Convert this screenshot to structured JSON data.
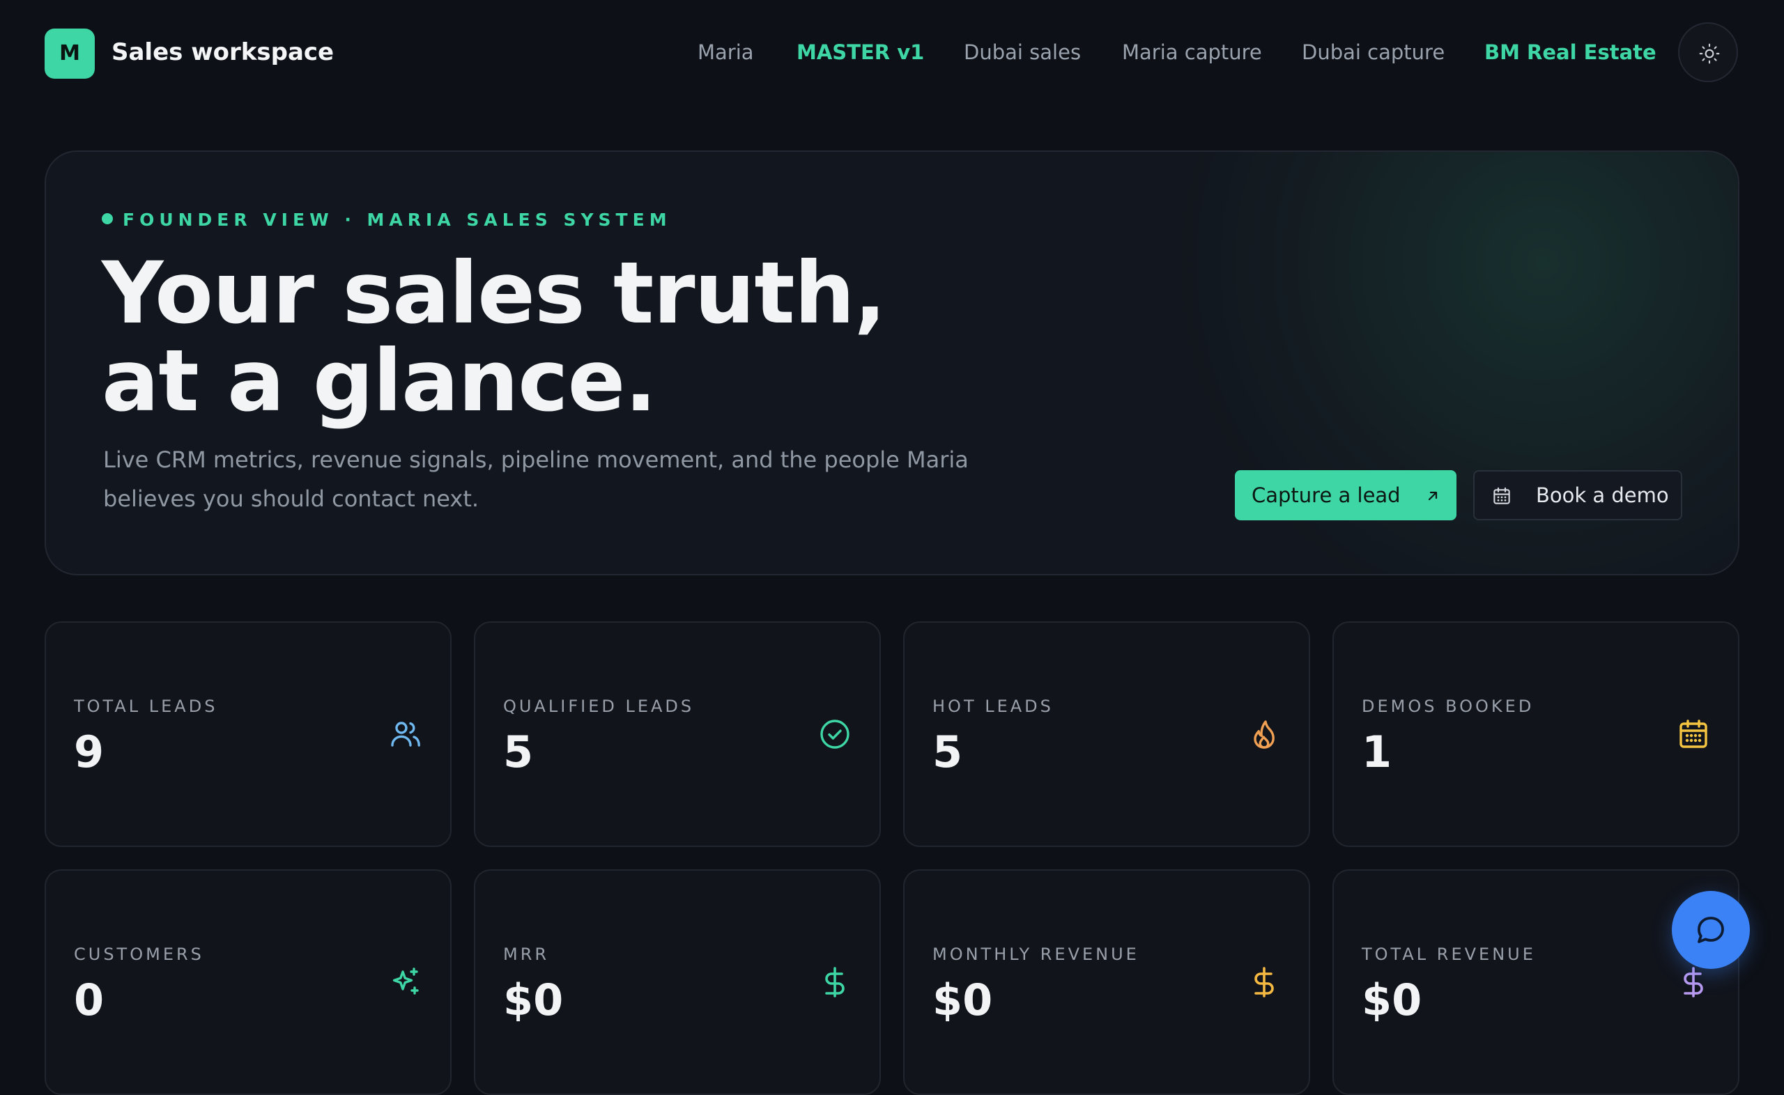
{
  "header": {
    "logo_letter": "M",
    "brand": "Sales workspace",
    "nav": [
      {
        "label": "Maria"
      },
      {
        "label": "MASTER v1"
      },
      {
        "label": "Dubai sales"
      },
      {
        "label": "Maria capture"
      },
      {
        "label": "Dubai capture"
      },
      {
        "label": "BM Real Estate"
      }
    ],
    "theme_toggle_icon": "sun-icon"
  },
  "hero": {
    "eyebrow": "FOUNDER VIEW · MARIA SALES SYSTEM",
    "title_line1": "Your sales truth,",
    "title_line2": "at a glance.",
    "subtitle": "Live CRM metrics, revenue signals, pipeline movement, and the people Maria believes you should contact next.",
    "capture_label": "Capture a lead",
    "demo_label": "Book a demo"
  },
  "stats": [
    {
      "label": "TOTAL LEADS",
      "value": "9",
      "icon": "users-icon",
      "color": "#6fb8f0"
    },
    {
      "label": "QUALIFIED LEADS",
      "value": "5",
      "icon": "check-circle-icon",
      "color": "#3dd6a4"
    },
    {
      "label": "HOT LEADS",
      "value": "5",
      "icon": "flame-icon",
      "color": "#f0a052"
    },
    {
      "label": "DEMOS BOOKED",
      "value": "1",
      "icon": "calendar-icon",
      "color": "#f5c542"
    },
    {
      "label": "CUSTOMERS",
      "value": "0",
      "icon": "sparkles-icon",
      "color": "#3dd6a4"
    },
    {
      "label": "MRR",
      "value": "$0",
      "icon": "dollar-icon",
      "color": "#3dd6a4"
    },
    {
      "label": "MONTHLY REVENUE",
      "value": "$0",
      "icon": "dollar-icon",
      "color": "#f5b942"
    },
    {
      "label": "TOTAL REVENUE",
      "value": "$0",
      "icon": "dollar-icon",
      "color": "#b89af0"
    }
  ],
  "colors": {
    "accent": "#3dd6a4",
    "background": "#0d1016",
    "chat_button": "#3b82f6"
  },
  "chat": {
    "icon": "chat-bubble-icon"
  }
}
